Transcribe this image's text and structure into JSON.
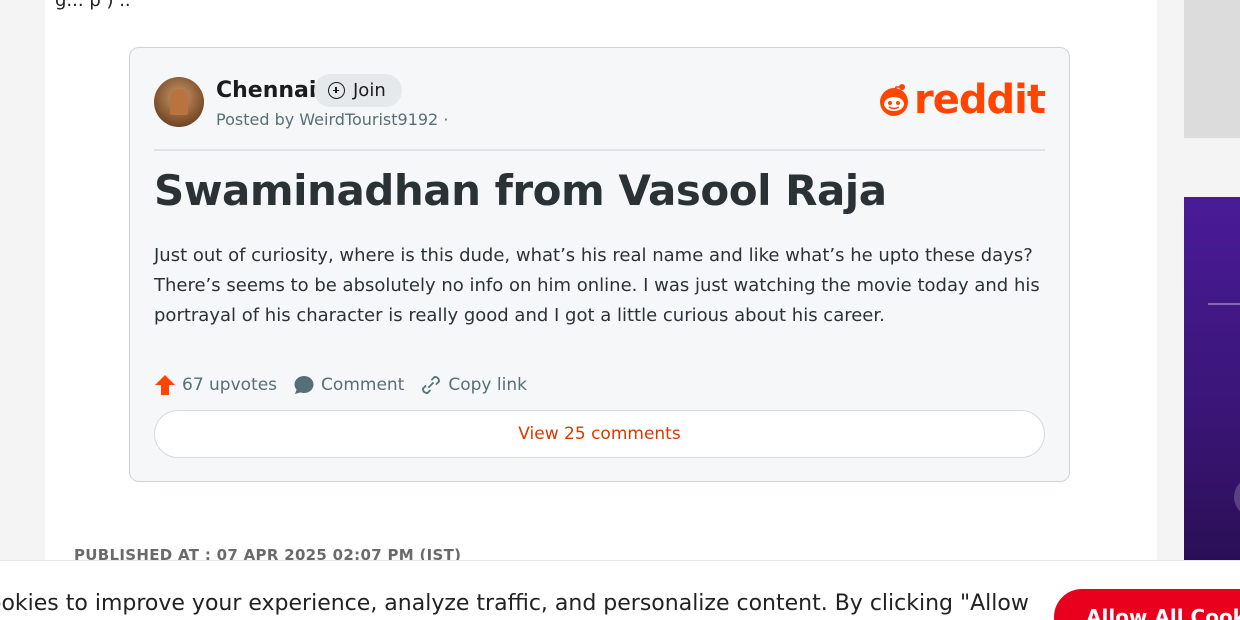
{
  "article": {
    "top_fragment": "g... p ) ..",
    "published": "PUBLISHED AT : 07 APR 2025 02:07 PM (IST)"
  },
  "reddit_embed": {
    "subreddit": "Chennai",
    "join_label": "Join",
    "posted_by": "Posted by WeirdTourist9192 ·",
    "brand_word": "reddit",
    "title": "Swaminadhan from Vasool Raja",
    "body": "Just out of curiosity, where is this dude, what’s his real name and like what’s he upto these days? There’s seems to be absolutely no info on him online. I was just watching the movie today and his portrayal of his character is really good and I got a little curious about his career.",
    "upvotes": "67 upvotes",
    "comment_label": "Comment",
    "copy_link_label": "Copy link",
    "view_comments": "View 25 comments",
    "colors": {
      "brand": "#ff4500",
      "link": "#d93a00"
    }
  },
  "cookie_banner": {
    "text": "ookies to improve your experience, analyze traffic, and personalize content. By clicking \"Allow",
    "allow_button": "Allow All Cook"
  },
  "icons": [
    "join-plus-icon",
    "reddit-logo-icon",
    "upvote-arrow-icon",
    "comment-icon",
    "link-icon"
  ]
}
